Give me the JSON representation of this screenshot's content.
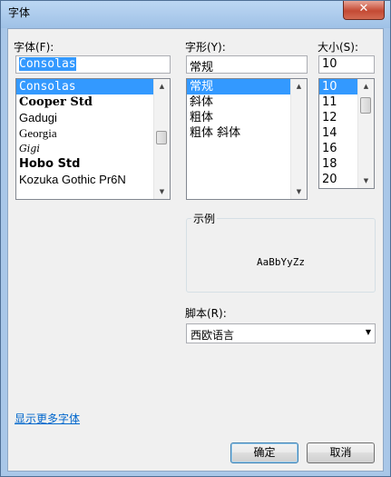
{
  "window": {
    "title": "字体",
    "close_glyph": "✕"
  },
  "font": {
    "label": "字体(F):",
    "value": "Consolas",
    "items": [
      {
        "label": "Consolas",
        "selected": true
      },
      {
        "label": "Cooper Std",
        "selected": false
      },
      {
        "label": "Gadugi",
        "selected": false
      },
      {
        "label": "Georgia",
        "selected": false
      },
      {
        "label": "Gigi",
        "selected": false
      },
      {
        "label": "Hobo Std",
        "selected": false
      },
      {
        "label": "Kozuka Gothic Pr6N",
        "selected": false
      }
    ]
  },
  "style": {
    "label": "字形(Y):",
    "value": "常规",
    "items": [
      {
        "label": "常规",
        "selected": true
      },
      {
        "label": "斜体",
        "selected": false
      },
      {
        "label": "粗体",
        "selected": false
      },
      {
        "label": "粗体 斜体",
        "selected": false
      }
    ]
  },
  "size": {
    "label": "大小(S):",
    "value": "10",
    "items": [
      {
        "label": "10",
        "selected": true
      },
      {
        "label": "11",
        "selected": false
      },
      {
        "label": "12",
        "selected": false
      },
      {
        "label": "14",
        "selected": false
      },
      {
        "label": "16",
        "selected": false
      },
      {
        "label": "18",
        "selected": false
      },
      {
        "label": "20",
        "selected": false
      }
    ]
  },
  "sample": {
    "label": "示例",
    "text": "AaBbYyZz"
  },
  "script": {
    "label": "脚本(R):",
    "value": "西欧语言"
  },
  "more_fonts_link": "显示更多字体",
  "buttons": {
    "ok": "确定",
    "cancel": "取消"
  },
  "scroll_glyphs": {
    "up": "▲",
    "down": "▼",
    "combo": "▼"
  }
}
